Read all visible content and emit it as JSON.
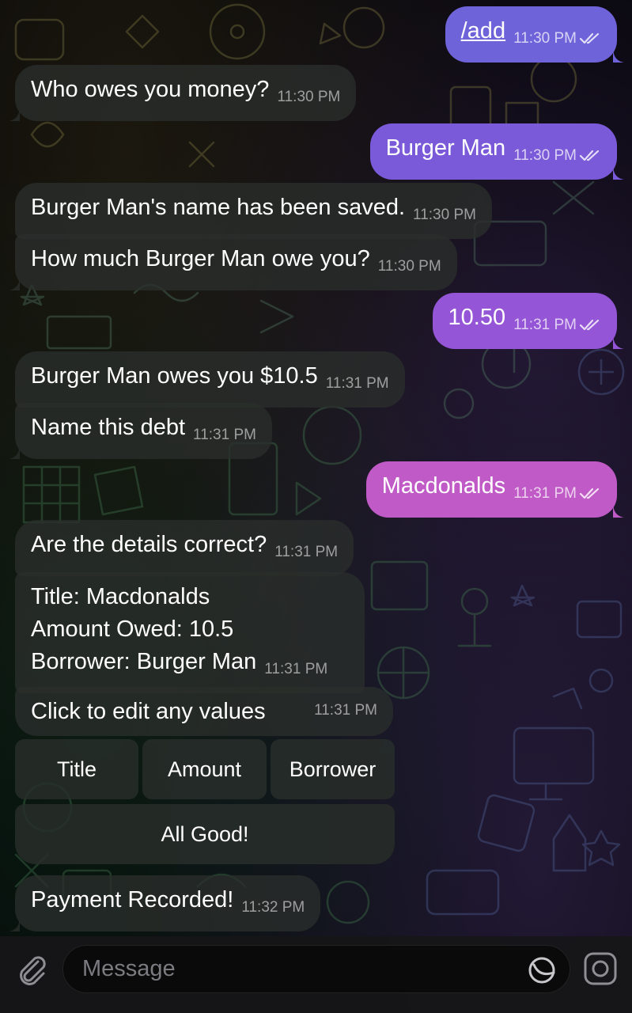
{
  "messages": [
    {
      "dir": "out",
      "text": "/add",
      "time": "11:30 PM",
      "link": true
    },
    {
      "dir": "in",
      "text": "Who owes you money?",
      "time": "11:30 PM"
    },
    {
      "dir": "out",
      "text": "Burger Man",
      "time": "11:30 PM"
    },
    {
      "dir": "in",
      "text": "Burger Man's name has been saved.",
      "time": "11:30 PM"
    },
    {
      "dir": "in",
      "text": "How much Burger Man owe you?",
      "time": "11:30 PM"
    },
    {
      "dir": "out",
      "text": "10.50",
      "time": "11:31 PM"
    },
    {
      "dir": "in",
      "text": "Burger Man owes you $10.5",
      "time": "11:31 PM"
    },
    {
      "dir": "in",
      "text": "Name this debt",
      "time": "11:31 PM"
    },
    {
      "dir": "out",
      "text": "Macdonalds",
      "time": "11:31 PM"
    },
    {
      "dir": "in",
      "text": "Are the details correct?",
      "time": "11:31 PM"
    },
    {
      "dir": "in",
      "lines": [
        "Title: Macdonalds",
        "Amount Owed: 10.5",
        "Borrower: Burger Man"
      ],
      "time": "11:31 PM"
    },
    {
      "dir": "in",
      "text": "Click to edit any values",
      "time": "11:31 PM"
    },
    {
      "dir": "in",
      "text": "Payment Recorded!",
      "time": "11:32 PM"
    }
  ],
  "keyboard": {
    "title": "Title",
    "amount": "Amount",
    "borrower": "Borrower",
    "all_good": "All Good!"
  },
  "composer": {
    "placeholder": "Message"
  },
  "icons": {
    "attach": "paperclip-icon",
    "sticker": "sticker-icon",
    "camera": "camera-icon",
    "read": "double-check-icon"
  },
  "colors": {
    "out_top": "#6f63d9",
    "out_mid": "#9955d6",
    "out_bottom": "#c25ac7",
    "in_bubble": "#2a2e2c"
  }
}
